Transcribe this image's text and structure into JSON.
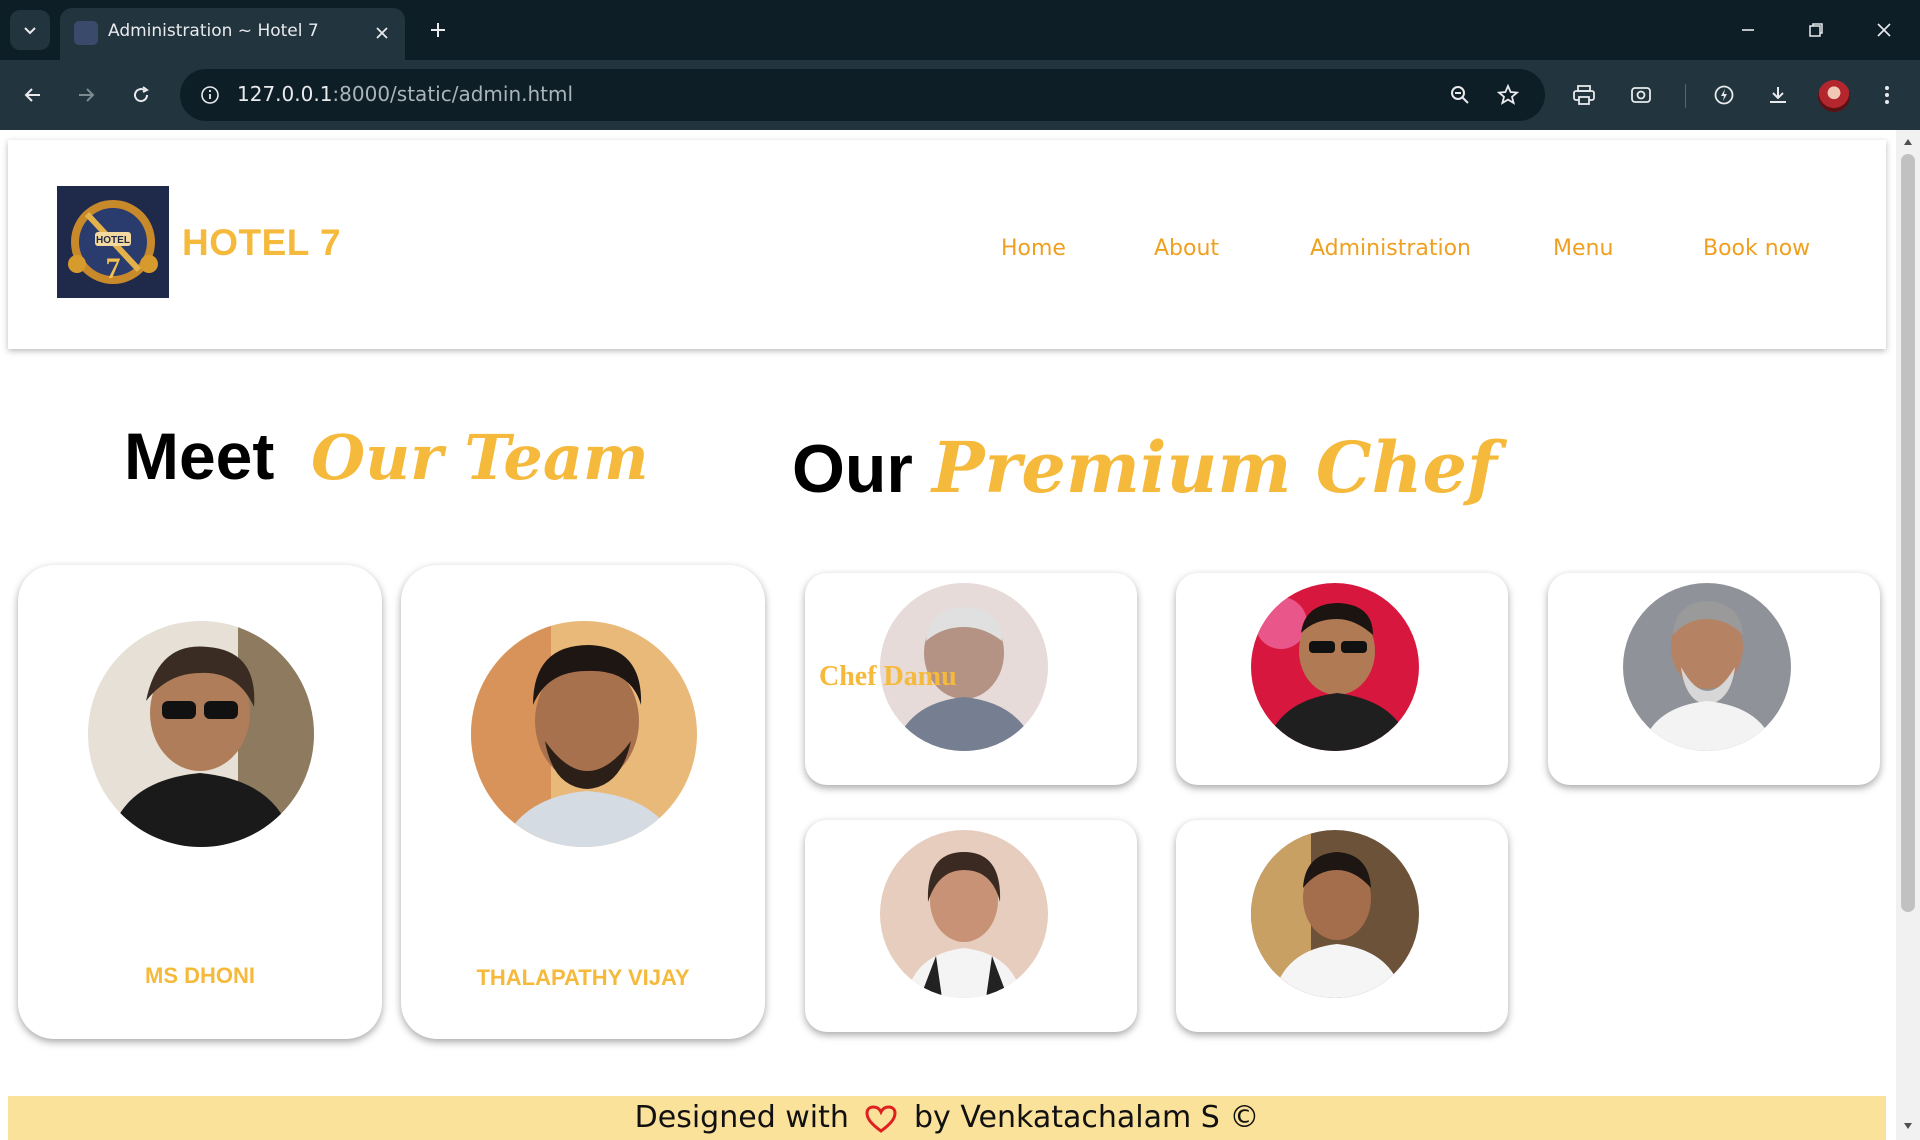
{
  "browser": {
    "tab_title": "Administration ~ Hotel 7",
    "url_host": "127.0.0.1",
    "url_rest": ":8000/static/admin.html"
  },
  "header": {
    "brand": "HOTEL 7",
    "nav": [
      "Home",
      "About",
      "Administration",
      "Menu",
      "Book now"
    ]
  },
  "team_section": {
    "heading_plain": "Meet",
    "heading_accent": "Our Team",
    "members": [
      {
        "name": "MS DHONI"
      },
      {
        "name": "THALAPATHY VIJAY"
      }
    ]
  },
  "chef_section": {
    "heading_plain": "Our",
    "heading_accent": "Premium Chef",
    "chefs": [
      {
        "label": "Chef Damu"
      },
      {
        "label": ""
      },
      {
        "label": ""
      },
      {
        "label": ""
      },
      {
        "label": ""
      }
    ]
  },
  "footer": {
    "prefix": "Designed with",
    "suffix": "by Venkatachalam S ©"
  },
  "colors": {
    "accent": "#f5b93b",
    "nav": "#f0a020",
    "footer_bg": "#fbe29b",
    "heart": "#e02020"
  }
}
